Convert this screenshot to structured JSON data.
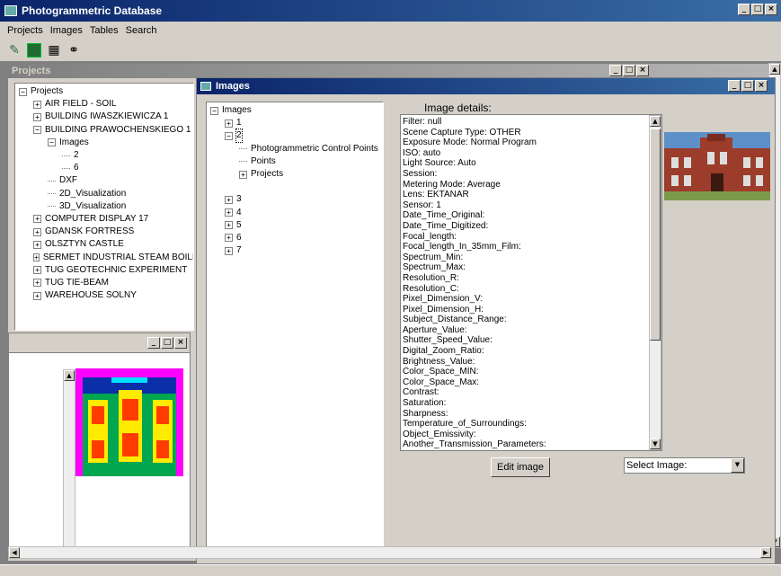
{
  "app": {
    "title": "Photogrammetric Database"
  },
  "window_buttons": {
    "min": "_",
    "max": "□",
    "close": "×"
  },
  "menu": {
    "items": [
      "Projects",
      "Images",
      "Tables",
      "Search"
    ]
  },
  "toolbar": {
    "icons": [
      "tools-icon",
      "database-icon",
      "grid-icon",
      "binoculars-icon"
    ]
  },
  "projects_window": {
    "title": "Projects"
  },
  "project_tree": {
    "root": "Projects",
    "items": [
      {
        "label": "AIR FIELD - SOIL",
        "indent": 1,
        "expander": "+"
      },
      {
        "label": "BUILDING IWASZKIEWICZA 1",
        "indent": 1,
        "expander": "+"
      },
      {
        "label": "BUILDING PRAWOCHENSKIEGO 1",
        "indent": 1,
        "expander": "-"
      },
      {
        "label": "Images",
        "indent": 2,
        "expander": "-"
      },
      {
        "label": "2",
        "indent": 3,
        "expander": ""
      },
      {
        "label": "6",
        "indent": 3,
        "expander": ""
      },
      {
        "label": "DXF",
        "indent": 2,
        "expander": ""
      },
      {
        "label": "2D_Visualization",
        "indent": 2,
        "expander": ""
      },
      {
        "label": "3D_Visualization",
        "indent": 2,
        "expander": ""
      },
      {
        "label": "COMPUTER DISPLAY 17",
        "indent": 1,
        "expander": "+"
      },
      {
        "label": "GDANSK FORTRESS",
        "indent": 1,
        "expander": "+"
      },
      {
        "label": "OLSZTYN CASTLE",
        "indent": 1,
        "expander": "+"
      },
      {
        "label": "SERMET INDUSTRIAL STEAM BOILER",
        "indent": 1,
        "expander": "+"
      },
      {
        "label": "TUG GEOTECHNIC EXPERIMENT",
        "indent": 1,
        "expander": "+"
      },
      {
        "label": "TUG TIE-BEAM",
        "indent": 1,
        "expander": "+"
      },
      {
        "label": "WAREHOUSE SOLNY",
        "indent": 1,
        "expander": "+"
      }
    ]
  },
  "images_window": {
    "title": "Images"
  },
  "image_tree": {
    "root": "Images",
    "items": [
      {
        "label": "1",
        "indent": 1,
        "expander": "+"
      },
      {
        "label": "2",
        "indent": 1,
        "expander": "-",
        "selected": true
      },
      {
        "label": "Photogrammetric Control Points",
        "indent": 2,
        "expander": ""
      },
      {
        "label": "Points",
        "indent": 2,
        "expander": ""
      },
      {
        "label": "Projects",
        "indent": 2,
        "expander": "+"
      },
      {
        "label": "",
        "indent": 0,
        "expander": ""
      },
      {
        "label": "3",
        "indent": 1,
        "expander": "+"
      },
      {
        "label": "4",
        "indent": 1,
        "expander": "+"
      },
      {
        "label": "5",
        "indent": 1,
        "expander": "+"
      },
      {
        "label": "6",
        "indent": 1,
        "expander": "+"
      },
      {
        "label": "7",
        "indent": 1,
        "expander": "+"
      }
    ]
  },
  "details": {
    "label": "Image details:",
    "lines": [
      "Filter: null",
      "Scene Capture Type: OTHER",
      "Exposure Mode: Normal Program",
      "ISO: auto",
      "Light Source: Auto",
      "Session:",
      "Metering Mode: Average",
      "Lens: EKTANAR",
      "Sensor: 1",
      "Date_Time_Original:",
      "Date_Time_Digitized:",
      "Focal_length:",
      "Focal_length_In_35mm_Film:",
      "Spectrum_Min:",
      "Spectrum_Max:",
      "Resolution_R:",
      "Resolution_C:",
      "Pixel_Dimension_V:",
      "Pixel_Dimension_H:",
      "Subject_Distance_Range:",
      "Aperture_Value:",
      "Shutter_Speed_Value:",
      "Digital_Zoom_Ratio:",
      "Brightness_Value:",
      "Color_Space_MIN:",
      "Color_Space_Max:",
      "Contrast:",
      "Saturation:",
      "Sharpness:",
      "Temperature_of_Surroundings:",
      "Object_Emissivity:",
      "Another_Transmission_Parameters:"
    ]
  },
  "buttons": {
    "edit_image": "Edit image"
  },
  "select_image": {
    "value": "Select Image:"
  }
}
